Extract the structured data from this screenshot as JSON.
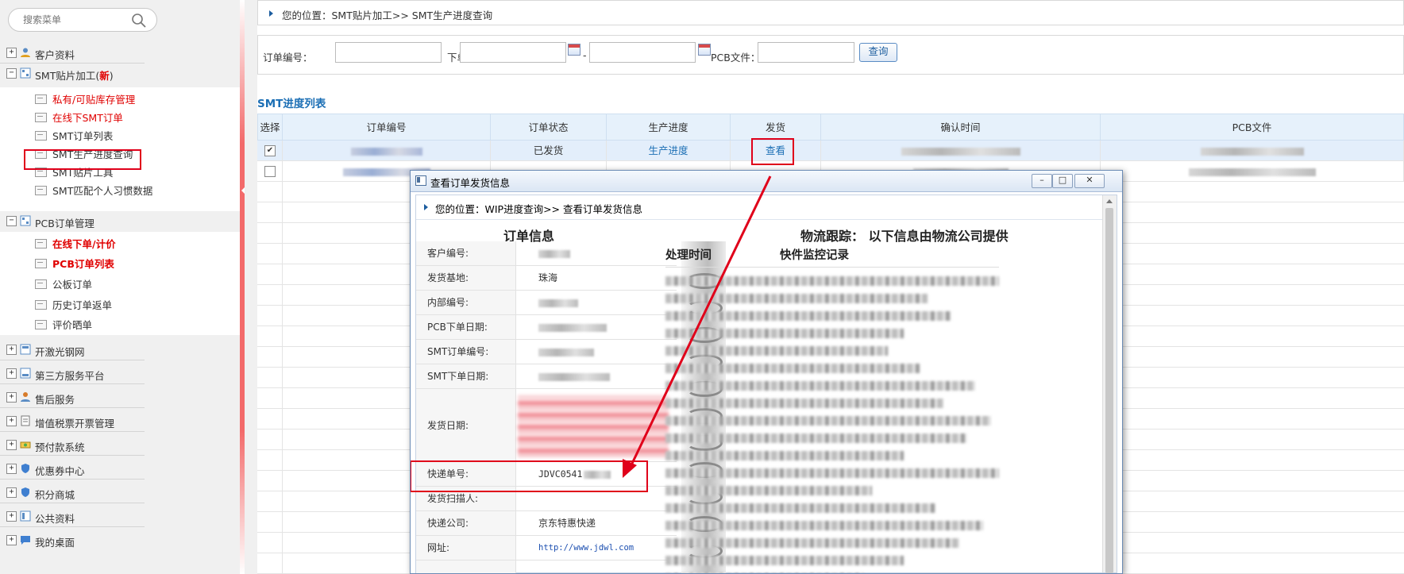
{
  "sidebar": {
    "search_placeholder": "搜索菜单",
    "menus": [
      {
        "label": "客户资料"
      },
      {
        "label": "SMT贴片加工(",
        "badge": "新",
        "suffix": ")"
      },
      {
        "label": "PCB订单管理"
      },
      {
        "label": "开激光钢网"
      },
      {
        "label": "第三方服务平台"
      },
      {
        "label": "售后服务"
      },
      {
        "label": "增值税票开票管理"
      },
      {
        "label": "预付款系统"
      },
      {
        "label": "优惠券中心"
      },
      {
        "label": "积分商城"
      },
      {
        "label": "公共资料"
      },
      {
        "label": "我的桌面"
      }
    ],
    "smt_sub": [
      "私有/可贴库存管理",
      "在线下SMT订单",
      "SMT订单列表",
      "SMT生产进度查询",
      "SMT贴片工具",
      "SMT匹配个人习惯数据"
    ],
    "pcb_sub": [
      "在线下单/计价",
      "PCB订单列表",
      "公板订单",
      "历史订单返单",
      "评价晒单"
    ]
  },
  "breadcrumb": "您的位置：SMT贴片加工>> SMT生产进度查询",
  "filter": {
    "order_no_label": "订单编号：",
    "order_date_label": "下单日期：",
    "dash": "-",
    "pcb_file_label": "PCB文件：",
    "query_label": "查询"
  },
  "list_title": "SMT进度列表",
  "table": {
    "headers": [
      "选择",
      "订单编号",
      "订单状态",
      "生产进度",
      "发货",
      "确认时间",
      "PCB文件"
    ],
    "row1": {
      "check": "✔",
      "status": "已发货",
      "progress": "生产进度",
      "ship": "查看"
    }
  },
  "modal": {
    "title": "查看订单发货信息",
    "breadcrumb": "您的位置：WIP进度查询>> 查看订单发货信息",
    "order_info_title": "订单信息",
    "logistics_title": "物流跟踪：  以下信息由物流公司提供",
    "log_time_header": "处理时间",
    "log_record_header": "快件监控记录",
    "fields": [
      {
        "label": "客户编号:",
        "value": ""
      },
      {
        "label": "发货基地:",
        "value": "珠海"
      },
      {
        "label": "内部编号:",
        "value": ""
      },
      {
        "label": "PCB下单日期:",
        "value": ""
      },
      {
        "label": "SMT订单编号:",
        "value": ""
      },
      {
        "label": "SMT下单日期:",
        "value": ""
      },
      {
        "label": "发货日期:",
        "value": ""
      },
      {
        "label": "快递单号:",
        "value": "JDVC0541"
      },
      {
        "label": "发货扫描人:",
        "value": ""
      },
      {
        "label": "快递公司:",
        "value": "京东特惠快递"
      },
      {
        "label": "网址:",
        "value": "http://www.jdwl.com"
      }
    ]
  },
  "colors": {
    "accent": "#1c6fb5",
    "highlight": "#e0001a",
    "header_bg": "#e6f1fb"
  }
}
